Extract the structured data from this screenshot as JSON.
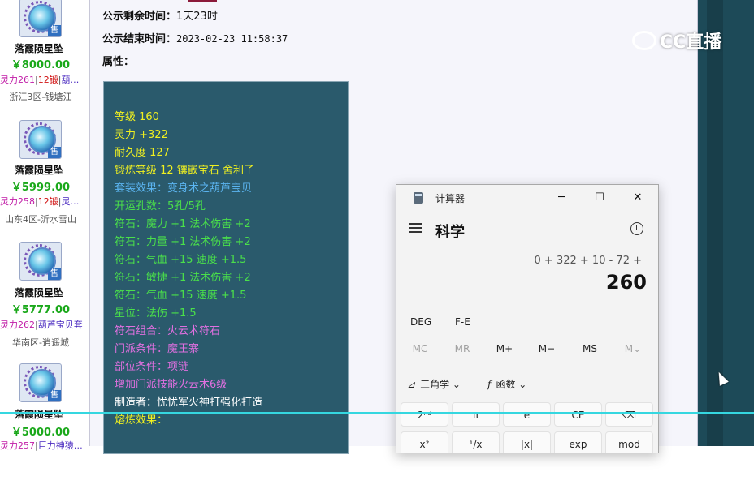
{
  "sidebar": {
    "items": [
      {
        "name": "落霞陨星坠",
        "price": "￥8000.00",
        "attr_ling": "灵力261",
        "attr_duan": "12锻",
        "attr_extra": "葫…",
        "server": "浙江3区-钱塘江",
        "sale": "售"
      },
      {
        "name": "落霞陨星坠",
        "price": "￥5999.00",
        "attr_ling": "灵力258",
        "attr_duan": "12锻",
        "attr_extra": "灵…",
        "server": "山东4区-沂水雪山",
        "sale": "售"
      },
      {
        "name": "落霞陨星坠",
        "price": "￥5777.00",
        "attr_ling": "灵力262",
        "attr_duan": "",
        "attr_extra": "葫芦宝贝套",
        "server": "华南区-逍遥城",
        "sale": "售"
      },
      {
        "name": "落霞陨星坠",
        "price": "￥5000.00",
        "attr_ling": "灵力257",
        "attr_duan": "",
        "attr_extra": "巨力神猿…",
        "server": "",
        "sale": "售"
      }
    ]
  },
  "main": {
    "remaining_label": "公示剩余时间：",
    "remaining_value": "1天23时",
    "end_label": "公示结束时间：",
    "end_value": "2023-02-23 11:58:37",
    "attr_label": "属性："
  },
  "attributes": [
    {
      "text": "等级 160",
      "color": "#f0f020"
    },
    {
      "text": "灵力 +322",
      "color": "#f0f020"
    },
    {
      "text": "耐久度 127",
      "color": "#f0f020"
    },
    {
      "text": "锻炼等级 12 镶嵌宝石 舍利子",
      "color": "#f0f020"
    },
    {
      "text": "套装效果：变身术之葫芦宝贝",
      "color": "#5bb4f0"
    },
    {
      "text": "开运孔数：5孔/5孔",
      "color": "#4ae04a"
    },
    {
      "text": "符石：魔力 +1 法术伤害 +2",
      "color": "#4ae04a"
    },
    {
      "text": "符石：力量 +1 法术伤害 +2",
      "color": "#4ae04a"
    },
    {
      "text": "符石：气血 +15 速度 +1.5",
      "color": "#4ae04a"
    },
    {
      "text": "符石：敏捷 +1 法术伤害 +2",
      "color": "#4ae04a"
    },
    {
      "text": "符石：气血 +15 速度 +1.5",
      "color": "#4ae04a"
    },
    {
      "text": "星位：法伤 +1.5",
      "color": "#4ae04a"
    },
    {
      "text": "符石组合：火云术符石",
      "color": "#e070e0"
    },
    {
      "text": "门派条件：魔王寨",
      "color": "#e070e0"
    },
    {
      "text": "部位条件：项链",
      "color": "#e070e0"
    },
    {
      "text": "增加门派技能火云术6级",
      "color": "#e070e0"
    },
    {
      "text": "制造者：忧忧军火神打强化打造",
      "color": "#ffffff"
    },
    {
      "text": "熔炼效果：",
      "color": "#f0f020"
    }
  ],
  "overlay": {
    "logo_text": "CC直播"
  },
  "calculator": {
    "title": "计算器",
    "mode": "科学",
    "expression": "0 + 322 + 10 - 72 +",
    "result": "260",
    "deg": "DEG",
    "fe": "F-E",
    "memory": [
      "MC",
      "MR",
      "M+",
      "M−",
      "MS",
      "M⌄"
    ],
    "trig": "三角学 ⌄",
    "func": "函数 ⌄",
    "func_icon": "f",
    "trig_icon": "⊿",
    "keys_row1": [
      "2ⁿᵈ",
      "π",
      "e",
      "CE",
      "⌫"
    ],
    "keys_row2": [
      "x²",
      "¹/x",
      "|x|",
      "exp",
      "mod"
    ],
    "window_controls": [
      "─",
      "☐",
      "✕"
    ]
  }
}
